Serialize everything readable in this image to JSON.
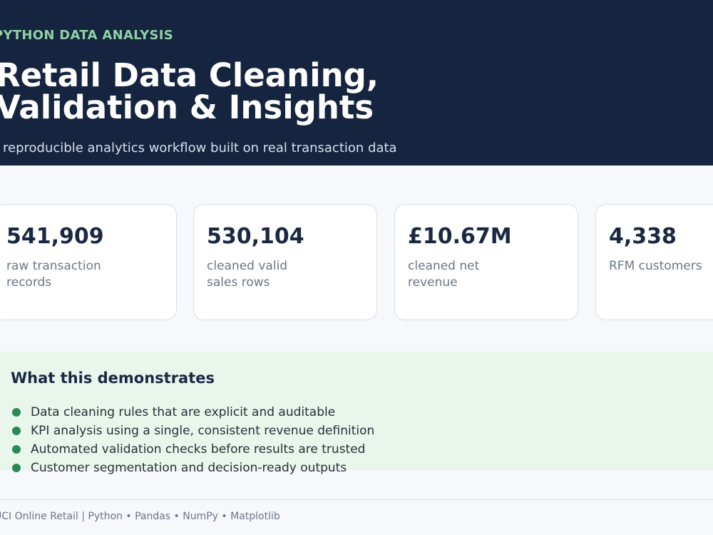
{
  "hero": {
    "eyebrow": "PYTHON DATA ANALYSIS",
    "title_line1": "Retail Data Cleaning,",
    "title_line2": "Validation & Insights",
    "subtitle": "A reproducible analytics workflow built on real transaction data"
  },
  "kpis": [
    {
      "value": "541,909",
      "label": "raw transaction\nrecords"
    },
    {
      "value": "530,104",
      "label": "cleaned valid\nsales rows"
    },
    {
      "value": "£10.67M",
      "label": "cleaned net\nrevenue"
    },
    {
      "value": "4,338",
      "label": "RFM customers"
    }
  ],
  "demonstrates": {
    "heading": "What this demonstrates",
    "items": [
      "Data cleaning rules that are explicit and auditable",
      "KPI analysis using a single, consistent revenue definition",
      "Automated validation checks before results are trusted",
      "Customer segmentation and decision-ready outputs"
    ]
  },
  "footer": {
    "text": "UCI Online Retail | Python • Pandas • NumPy • Matplotlib"
  },
  "colors": {
    "hero_bg": "#152540",
    "accent_green": "#8fd0a6",
    "bullet_green": "#2a8a55",
    "panel_green": "#e8f6ec",
    "text_dark": "#1a2842"
  }
}
